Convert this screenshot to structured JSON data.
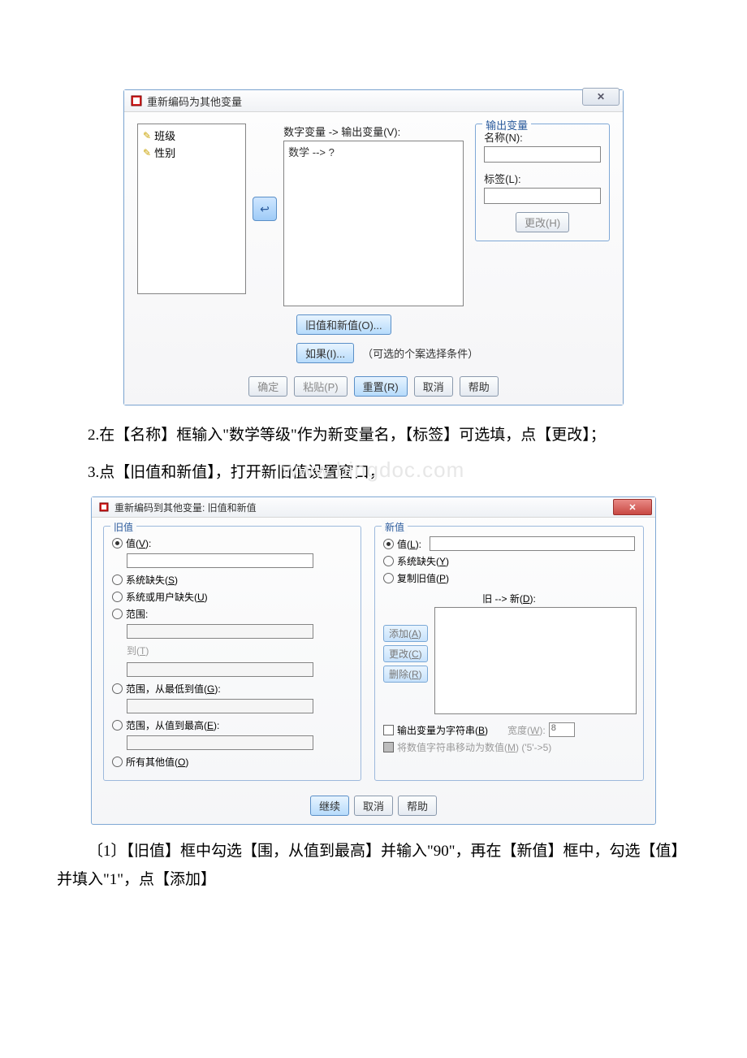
{
  "dlg1": {
    "title": "重新编码为其他变量",
    "close": "✕",
    "srcItems": [
      "班级",
      "性别"
    ],
    "mapLabel": "数字变量 -> 输出变量(V):",
    "mapEntry": "数学 --> ?",
    "outGroup": {
      "legend": "输出变量",
      "nameLbl": "名称(N):",
      "labelLbl": "标签(L):",
      "changeBtn": "更改(H)"
    },
    "oldNewBtn": "旧值和新值(O)...",
    "ifBtn": "如果(I)...",
    "ifText": "（可选的个案选择条件）",
    "actions": {
      "ok": "确定",
      "paste": "粘贴(P)",
      "reset": "重置(R)",
      "cancel": "取消",
      "help": "帮助"
    }
  },
  "para1": "2.在【名称】框输入\"数学等级\"作为新变量名，【标签】可选填，点【更改】；",
  "para2": "3.点【旧值和新值】，打开新旧值设置窗口，",
  "watermark": "www.bingdoc.com",
  "dlg2": {
    "title": "重新编码到其他变量: 旧值和新值",
    "close": "✕",
    "old": {
      "legend": "旧值",
      "value": "值(V):",
      "sysmis": "系统缺失(S)",
      "sysuser": "系统或用户缺失(U)",
      "range": "范围:",
      "to": "到(T)",
      "rangeLow": "范围，从最低到值(G):",
      "rangeHigh": "范围，从值到最高(E):",
      "allOther": "所有其他值(O)"
    },
    "new": {
      "legend": "新值",
      "value": "值(L):",
      "sysmis": "系统缺失(Y)",
      "copy": "复制旧值(P)",
      "oldnewLbl": "旧 --> 新(D):",
      "add": "添加(A)",
      "change": "更改(C)",
      "remove": "删除(R)",
      "strOut": "输出变量为字符串(B)",
      "widthLbl": "宽度(W):",
      "widthVal": "8",
      "convert": "将数值字符串移动为数值(M) ('5'->5)"
    },
    "actions": {
      "cont": "继续",
      "cancel": "取消",
      "help": "帮助"
    }
  },
  "para3": "〔1〕【旧值】框中勾选【围，从值到最高】并输入\"90\"，再在【新值】框中，勾选【值】并填入\"1\"，点【添加】"
}
